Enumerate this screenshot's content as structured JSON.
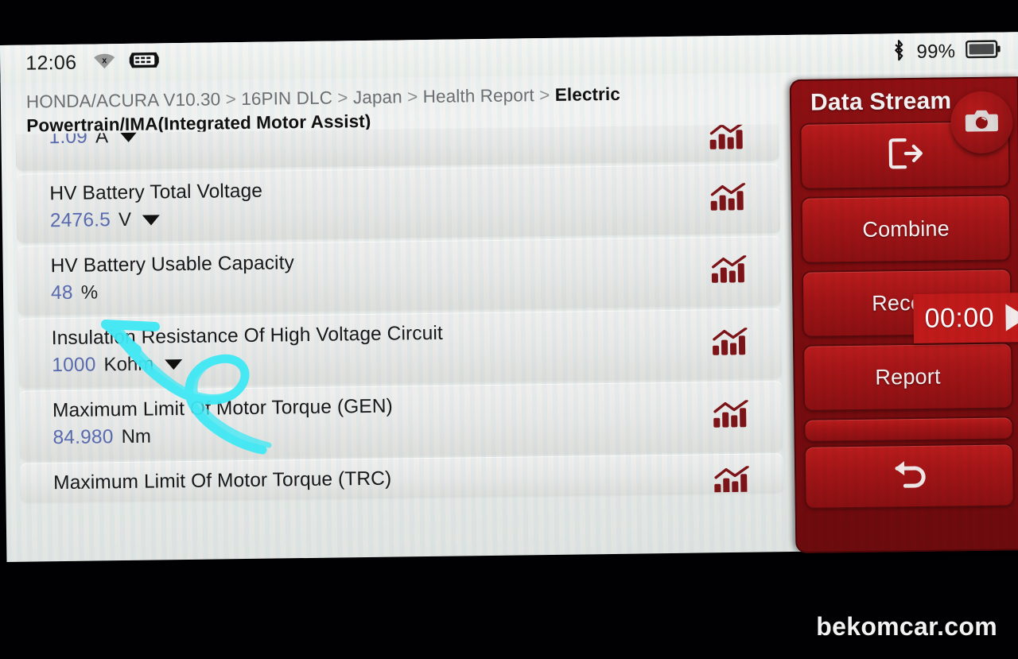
{
  "status_bar": {
    "time": "12:06",
    "wifi_icon": "wifi-off-icon",
    "dlc_icon": "obd-connector-icon",
    "bluetooth_icon": "bluetooth-icon",
    "battery_percent": "99%",
    "battery_icon": "battery-full-icon"
  },
  "breadcrumb": {
    "items": [
      "HONDA/ACURA V10.30",
      "16PIN DLC",
      "Japan",
      "Health Report"
    ],
    "separator": ">",
    "current": "Electric Powertrain/IMA(Integrated Motor Assist)"
  },
  "data_stream": {
    "rows": [
      {
        "label": "",
        "value": "1.09",
        "unit": "A",
        "has_caret": true,
        "chart_icon": "bar-chart-icon",
        "clipped_top": true
      },
      {
        "label": "HV Battery Total Voltage",
        "value": "2476.5",
        "unit": "V",
        "has_caret": true,
        "chart_icon": "bar-chart-icon"
      },
      {
        "label": "HV Battery Usable Capacity",
        "value": "48",
        "unit": "%",
        "has_caret": false,
        "chart_icon": "bar-chart-icon"
      },
      {
        "label": "Insulation Resistance Of High Voltage Circuit",
        "value": "1000",
        "unit": "Kohm",
        "has_caret": true,
        "chart_icon": "bar-chart-icon"
      },
      {
        "label": "Maximum Limit Of Motor Torque (GEN)",
        "value": "84.980",
        "unit": "Nm",
        "has_caret": false,
        "chart_icon": "bar-chart-icon"
      },
      {
        "label": "Maximum Limit Of Motor Torque (TRC)",
        "value": "",
        "unit": "",
        "has_caret": false,
        "chart_icon": "bar-chart-icon",
        "clipped_bottom": true
      }
    ]
  },
  "side_panel": {
    "title": "Data Stream",
    "camera_button": {
      "icon": "camera-icon"
    },
    "buttons": [
      {
        "label": "",
        "icon": "exit-icon",
        "name": "exit-button"
      },
      {
        "label": "Combine",
        "icon": "",
        "name": "combine-button"
      },
      {
        "label": "Record",
        "icon": "",
        "name": "record-button"
      },
      {
        "label": "Report",
        "icon": "",
        "name": "report-button"
      },
      {
        "label": "",
        "icon": "",
        "name": "partial-button"
      },
      {
        "label": "",
        "icon": "back-arrow-icon",
        "name": "back-button"
      }
    ],
    "record_timer": {
      "time": "00:00",
      "play_icon": "play-icon"
    }
  },
  "annotation": {
    "color": "#3fe8f5",
    "shape": "curved-arrow-pointing-to-usable-capacity"
  },
  "watermark": "bekomcar.com",
  "colors": {
    "panel_red": "#8e1013",
    "button_red": "#a41517",
    "timer_red": "#c11a1a",
    "value_blue": "#5a6bb0",
    "chart_icon_red": "#7d1418",
    "annotation_cyan": "#3fe8f5"
  }
}
